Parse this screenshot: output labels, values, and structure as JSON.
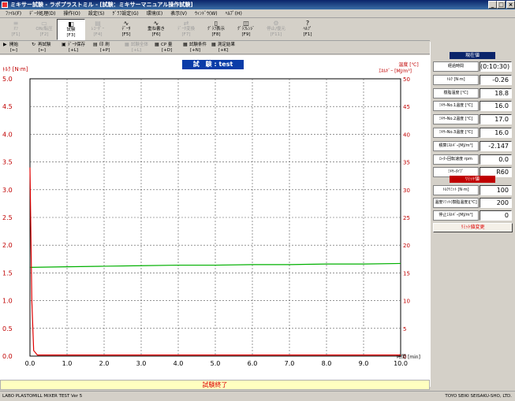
{
  "window": {
    "title": "ミキサー試験 - ラボプラストミル - [試験：ミキサーマニュアル操作試験]",
    "min": "_",
    "max": "□",
    "close": "×"
  },
  "menu": [
    "ﾌｧｲﾙ(F)",
    "ﾃﾞｰﾀ処理(D)",
    "操作(O)",
    "設定(S)",
    "ｸﾞﾗﾌ設定(G)",
    "環境(E)",
    "表示(V)",
    "ｳｨﾝﾄﾞｳ(W)",
    "ﾍﾙﾌﾟ(H)"
  ],
  "toolbar": [
    {
      "label": "ｵﾌ",
      "fkey": "[F1]",
      "icon": "≡",
      "disabled": true
    },
    {
      "label": "ON/転圧",
      "fkey": "[F2]",
      "icon": "▭",
      "disabled": true
    },
    {
      "label": "試験",
      "fkey": "[F3]",
      "icon": "◧",
      "active": true
    },
    {
      "label": "ﾚｺｰﾀﾞｰ",
      "fkey": "[F4]",
      "icon": "▤",
      "disabled": true
    },
    {
      "label": "ﾃﾞｰﾀ",
      "fkey": "[F5]",
      "icon": "∿"
    },
    {
      "label": "重ね書き",
      "fkey": "[F6]",
      "icon": "∿"
    },
    {
      "label": "ﾃﾞｰﾀ変換",
      "fkey": "[F7]",
      "icon": "⇄",
      "disabled": true
    },
    {
      "label": "ｸﾞﾗﾌ表示",
      "fkey": "[F8]",
      "icon": "▯"
    },
    {
      "label": "ｸﾞﾗﾌﾚﾝｼﾞ",
      "fkey": "[F9]",
      "icon": "◫"
    },
    {
      "label": "停止/復元",
      "fkey": "[F11]",
      "icon": "⚙",
      "disabled": true
    },
    {
      "label": "ﾍﾙﾌﾟ",
      "fkey": "[F1]",
      "icon": "?"
    }
  ],
  "toolbar2": [
    {
      "label": "開始",
      "fkey": "[←]",
      "icon": "▶"
    },
    {
      "label": "再試験",
      "fkey": "[←]",
      "icon": "↻"
    },
    {
      "label": "ﾃﾞｰﾀ保存",
      "fkey": "[+L]",
      "icon": "▣"
    },
    {
      "label": "印 刷",
      "fkey": "[+P]",
      "icon": "▤"
    },
    {
      "label": "試験全体",
      "fkey": "[+L]",
      "icon": "▦",
      "disabled": true
    },
    {
      "label": "CP 量",
      "fkey": "[+D]",
      "icon": "▦"
    },
    {
      "label": "試験条件",
      "fkey": "[+N]",
      "icon": "▦"
    },
    {
      "label": "測定結果",
      "fkey": "[+K]",
      "icon": "▦"
    }
  ],
  "test_label": "試　験 : test",
  "current_header": "現在値",
  "current_rows": [
    {
      "label": "経過時間",
      "value": "(0:10:30)"
    },
    {
      "label": "ﾄﾙｸ [N·m]",
      "value": "-0.26"
    },
    {
      "label": "樹脂温度 [℃]",
      "value": "18.8"
    },
    {
      "label": "ﾐｷｻｰNo.1温度 [℃]",
      "value": "16.0"
    },
    {
      "label": "ﾐｷｻｰNo.2温度 [℃]",
      "value": "17.0"
    },
    {
      "label": "ﾐｷｻｰNo.3温度 [℃]",
      "value": "16.0"
    },
    {
      "label": "積算ｴﾈﾙｷﾞｰ[MJ/m³]",
      "value": "-2.147"
    },
    {
      "label": "ﾛｰﾀｰ回転速度 rpm",
      "value": "0.0"
    },
    {
      "label": "ﾐｷｻｰﾀｲﾌﾟ",
      "value": "R60"
    }
  ],
  "limit_header": "ﾘﾐｯﾄ値",
  "limit_rows": [
    {
      "label": "ﾄﾙｸﾘﾐｯﾄ [N·m]",
      "value": "100"
    },
    {
      "label": "温度ﾘﾐｯﾄ(樹脂温度)[℃]",
      "value": "200"
    },
    {
      "label": "停止ｴﾈﾙｷﾞｰ[MJ/m³]",
      "value": "0"
    }
  ],
  "limit_button": "ﾘﾐｯﾄ値変更",
  "status_box": "試験終了",
  "statusbar_left": "LABO PLASTOMILL MIXER TEST  Ver 5",
  "statusbar_right": "TOYO SEIKI SEISAKU-SHO, LTD.",
  "chart_data": {
    "type": "line",
    "ylabel_left": "ﾄﾙｸ [N·m]",
    "ylabel_right_1": "温度 [℃]",
    "ylabel_right_2": "ｴﾈﾙｷﾞｰ [MJ/m³]",
    "xlabel": "時間 [min]",
    "xlim": [
      0,
      10
    ],
    "ylim_left": [
      0,
      5
    ],
    "ylim_right": [
      0,
      50
    ],
    "x_ticks": [
      "0.0",
      "1.0",
      "2.0",
      "3.0",
      "4.0",
      "5.0",
      "6.0",
      "7.0",
      "8.0",
      "9.0",
      "10.0"
    ],
    "y_ticks_left": [
      "0.0",
      "0.5",
      "1.0",
      "1.5",
      "2.0",
      "2.5",
      "3.0",
      "3.5",
      "4.0",
      "4.5",
      "5.0"
    ],
    "y_ticks_right": [
      "0",
      "5",
      "10",
      "15",
      "20",
      "25",
      "30",
      "35",
      "40",
      "45",
      "50"
    ],
    "grid": true,
    "series": [
      {
        "color": "#00b000",
        "x": [
          0,
          1,
          2,
          3,
          4,
          5,
          6,
          7,
          8,
          9,
          10
        ],
        "y": [
          16.0,
          16.1,
          16.2,
          16.3,
          16.4,
          16.4,
          16.5,
          16.5,
          16.6,
          16.6,
          16.7
        ]
      },
      {
        "color": "#e00000",
        "x": [
          0,
          0.05,
          0.1,
          0.2,
          1,
          2,
          3,
          4,
          5,
          6,
          7,
          8,
          9,
          10
        ],
        "y": [
          3.4,
          1.0,
          0.1,
          0.02,
          0.02,
          0.02,
          0.02,
          0.02,
          0.02,
          0.02,
          0.02,
          0.02,
          0.02,
          0.02
        ]
      }
    ]
  }
}
